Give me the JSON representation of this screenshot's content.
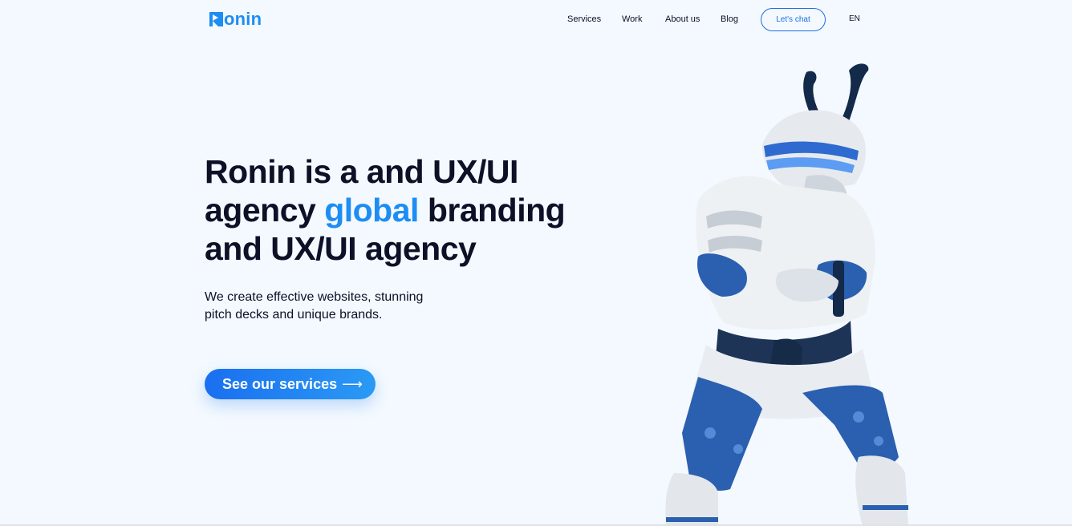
{
  "brand": {
    "logo_text": "onin",
    "accent_color": "#1d8df3"
  },
  "nav": {
    "items": [
      "Services",
      "Work",
      "About us",
      "Blog"
    ],
    "chat_label": "Let's chat",
    "lang": "EN"
  },
  "hero": {
    "title_line1": "Ronin is a and UX/UI",
    "title_line2_pre": "agency ",
    "title_line2_accent": "global",
    "title_line2_post": " branding",
    "title_line3": "and UX/UI agency",
    "subtitle_line1": "We create effective websites, stunning",
    "subtitle_line2": "pitch decks and unique brands.",
    "cta_label": "See our services",
    "cta_icon": "arrow-right-icon"
  },
  "illustration": {
    "subject": "samurai-illustration",
    "colors": [
      "#e9ecef",
      "#2b5fb0",
      "#142a4a"
    ]
  }
}
